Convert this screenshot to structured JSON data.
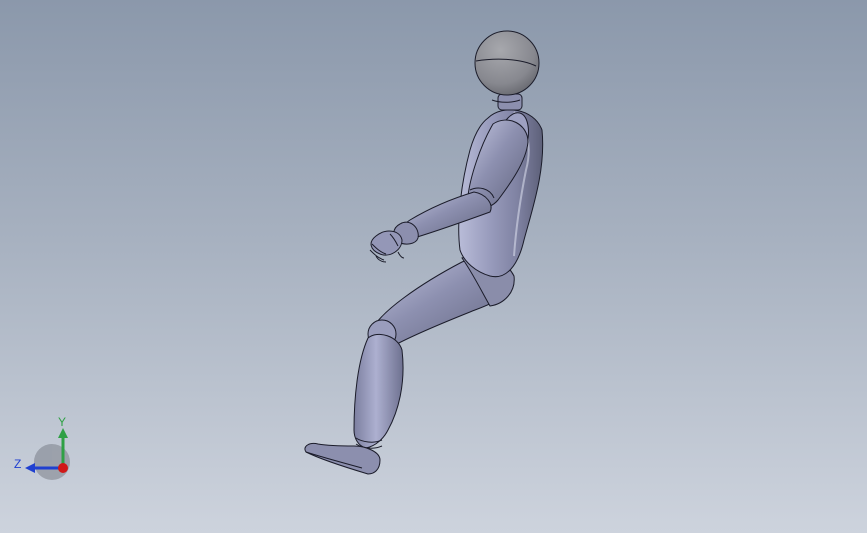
{
  "viewport": {
    "background_top": "#8b98ab",
    "background_bottom": "#cdd3dd"
  },
  "model": {
    "name": "mannequin-model",
    "color": "#8c8fae",
    "edge_color": "#1b1c2a"
  },
  "triad": {
    "y_label": "Y",
    "z_label": "Z",
    "colors": {
      "y": "#2fa045",
      "z": "#2040d0",
      "x": "#d01818"
    }
  }
}
